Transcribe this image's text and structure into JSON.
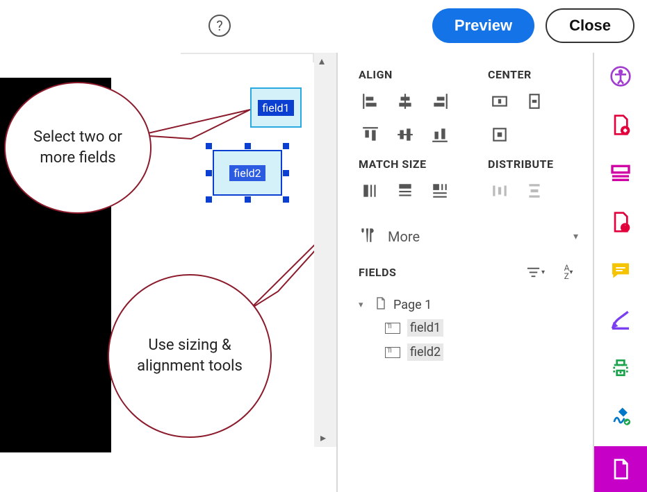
{
  "topbar": {
    "help_label": "?",
    "preview": "Preview",
    "close": "Close"
  },
  "canvas": {
    "field1": {
      "label": "field1"
    },
    "field2": {
      "label": "field2"
    }
  },
  "callouts": {
    "select_fields": "Select two or more fields",
    "use_tools": "Use sizing & alignment tools"
  },
  "panel": {
    "sections": {
      "align": "ALIGN",
      "center": "CENTER",
      "match_size": "MATCH SIZE",
      "distribute": "DISTRIBUTE"
    },
    "more": "More",
    "fields_header": "FIELDS",
    "tree": {
      "page": "Page 1",
      "items": [
        "field1",
        "field2"
      ]
    }
  },
  "rail": {
    "icons": [
      "accessibility",
      "add-pdf",
      "layout",
      "pdf-info",
      "comment",
      "edit",
      "print",
      "sign",
      "file-active"
    ]
  },
  "tool_icons": {
    "align": [
      "align-left",
      "align-center-h",
      "align-right",
      "align-top",
      "align-center-v",
      "align-bottom"
    ],
    "center": [
      "center-h",
      "center-v",
      "center-both"
    ],
    "match": [
      "match-width",
      "match-height",
      "match-both"
    ],
    "distribute": [
      "distribute-h",
      "distribute-v"
    ]
  }
}
